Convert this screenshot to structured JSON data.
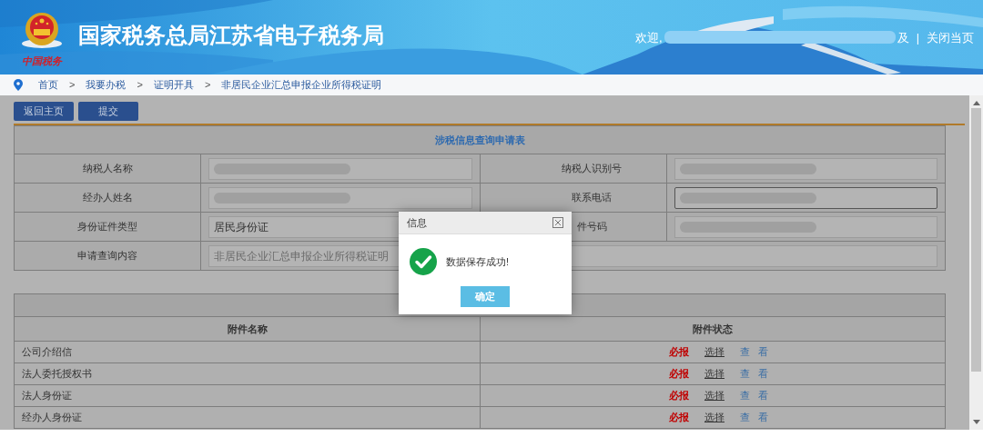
{
  "header": {
    "title": "国家税务总局江苏省电子税务局",
    "logo_caption": "中国税务",
    "welcome": "欢迎,",
    "welcome_tail": "及",
    "separator": "|",
    "close_link": "关闭当页"
  },
  "breadcrumb": {
    "items": [
      "首页",
      "我要办税",
      "证明开具",
      "非居民企业汇总申报企业所得税证明"
    ],
    "separators": [
      ">",
      ">",
      ">"
    ]
  },
  "toolbar": [
    "返回主页",
    "提交"
  ],
  "form": {
    "title": "涉税信息查询申请表",
    "rows": [
      {
        "cells": [
          {
            "kind": "label",
            "text": "纳税人名称"
          },
          {
            "kind": "field",
            "redacted": true,
            "focused": false
          },
          {
            "kind": "label",
            "text": "纳税人识别号"
          },
          {
            "kind": "field",
            "redacted": true,
            "focused": false
          }
        ]
      },
      {
        "cells": [
          {
            "kind": "label",
            "text": "经办人姓名"
          },
          {
            "kind": "field",
            "redacted": true,
            "focused": false
          },
          {
            "kind": "label",
            "text": "联系电话"
          },
          {
            "kind": "field",
            "redacted": true,
            "focused": true
          }
        ]
      },
      {
        "cells": [
          {
            "kind": "label",
            "text": "身份证件类型"
          },
          {
            "kind": "field",
            "value": "居民身份证",
            "readonly": false,
            "redacted": false,
            "focused": false
          },
          {
            "kind": "label",
            "text": "件号码"
          },
          {
            "kind": "field",
            "redacted": true,
            "focused": false
          }
        ]
      },
      {
        "cells": [
          {
            "kind": "label",
            "text": "申请查询内容"
          },
          {
            "kind": "field",
            "colspan": 3,
            "readonly": true,
            "value": "非居民企业汇总申报企业所得税证明",
            "redacted": false,
            "focused": false
          }
        ]
      }
    ]
  },
  "attachments": {
    "columns": [
      "附件名称",
      "附件状态"
    ],
    "rows": [
      {
        "name": "公司介绍信",
        "requirement": "必报",
        "select": "选择",
        "view": "查 看"
      },
      {
        "name": "法人委托授权书",
        "requirement": "必报",
        "select": "选择",
        "view": "查 看"
      },
      {
        "name": "法人身份证",
        "requirement": "必报",
        "select": "选择",
        "view": "查 看"
      },
      {
        "name": "经办人身份证",
        "requirement": "必报",
        "select": "选择",
        "view": "查 看"
      }
    ]
  },
  "dialog": {
    "title": "信息",
    "message": "数据保存成功!",
    "button": "确定"
  }
}
